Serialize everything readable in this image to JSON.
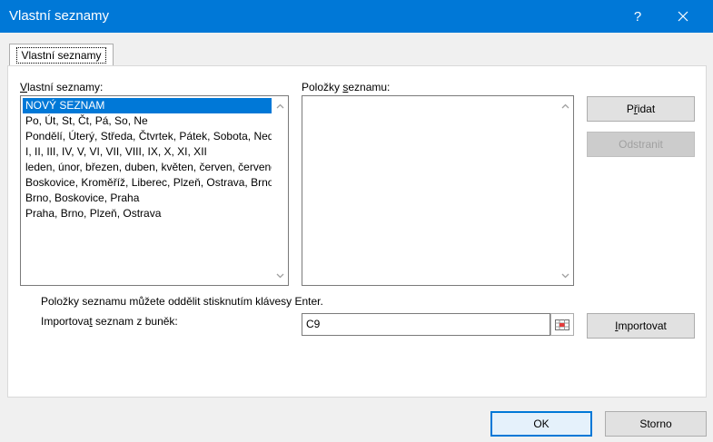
{
  "window": {
    "title": "Vlastní seznamy",
    "help_label": "?"
  },
  "tab": {
    "label": "Vlastní seznamy"
  },
  "custom_lists": {
    "label_pre": "",
    "label_ul": "V",
    "label_post": "lastní seznamy:",
    "items": [
      "NOVÝ SEZNAM",
      "Po, Út, St, Čt, Pá, So, Ne",
      "Pondělí, Úterý, Středa, Čtvrtek, Pátek, Sobota, Neděle",
      "I, II, III, IV, V, VI, VII, VIII, IX, X, XI, XII",
      "leden, únor, březen, duben, květen, červen, červenec",
      "Boskovice, Kroměříž, Liberec, Plzeň, Ostrava, Brno",
      "Brno, Boskovice, Praha",
      "Praha, Brno, Plzeň, Ostrava"
    ]
  },
  "list_entries": {
    "label_pre": "Položky ",
    "label_ul": "s",
    "label_post": "eznamu:"
  },
  "buttons": {
    "add_pre": "P",
    "add_ul": "ř",
    "add_post": "idat",
    "remove": "Odstranit",
    "import_pre": "",
    "import_ul": "I",
    "import_post": "mportovat",
    "ok": "OK",
    "cancel": "Storno"
  },
  "hint": "Položky seznamu můžete oddělit stisknutím klávesy Enter.",
  "import_field": {
    "label_pre": "Importova",
    "label_ul": "t",
    "label_post": " seznam z buněk:",
    "value": "C9"
  }
}
